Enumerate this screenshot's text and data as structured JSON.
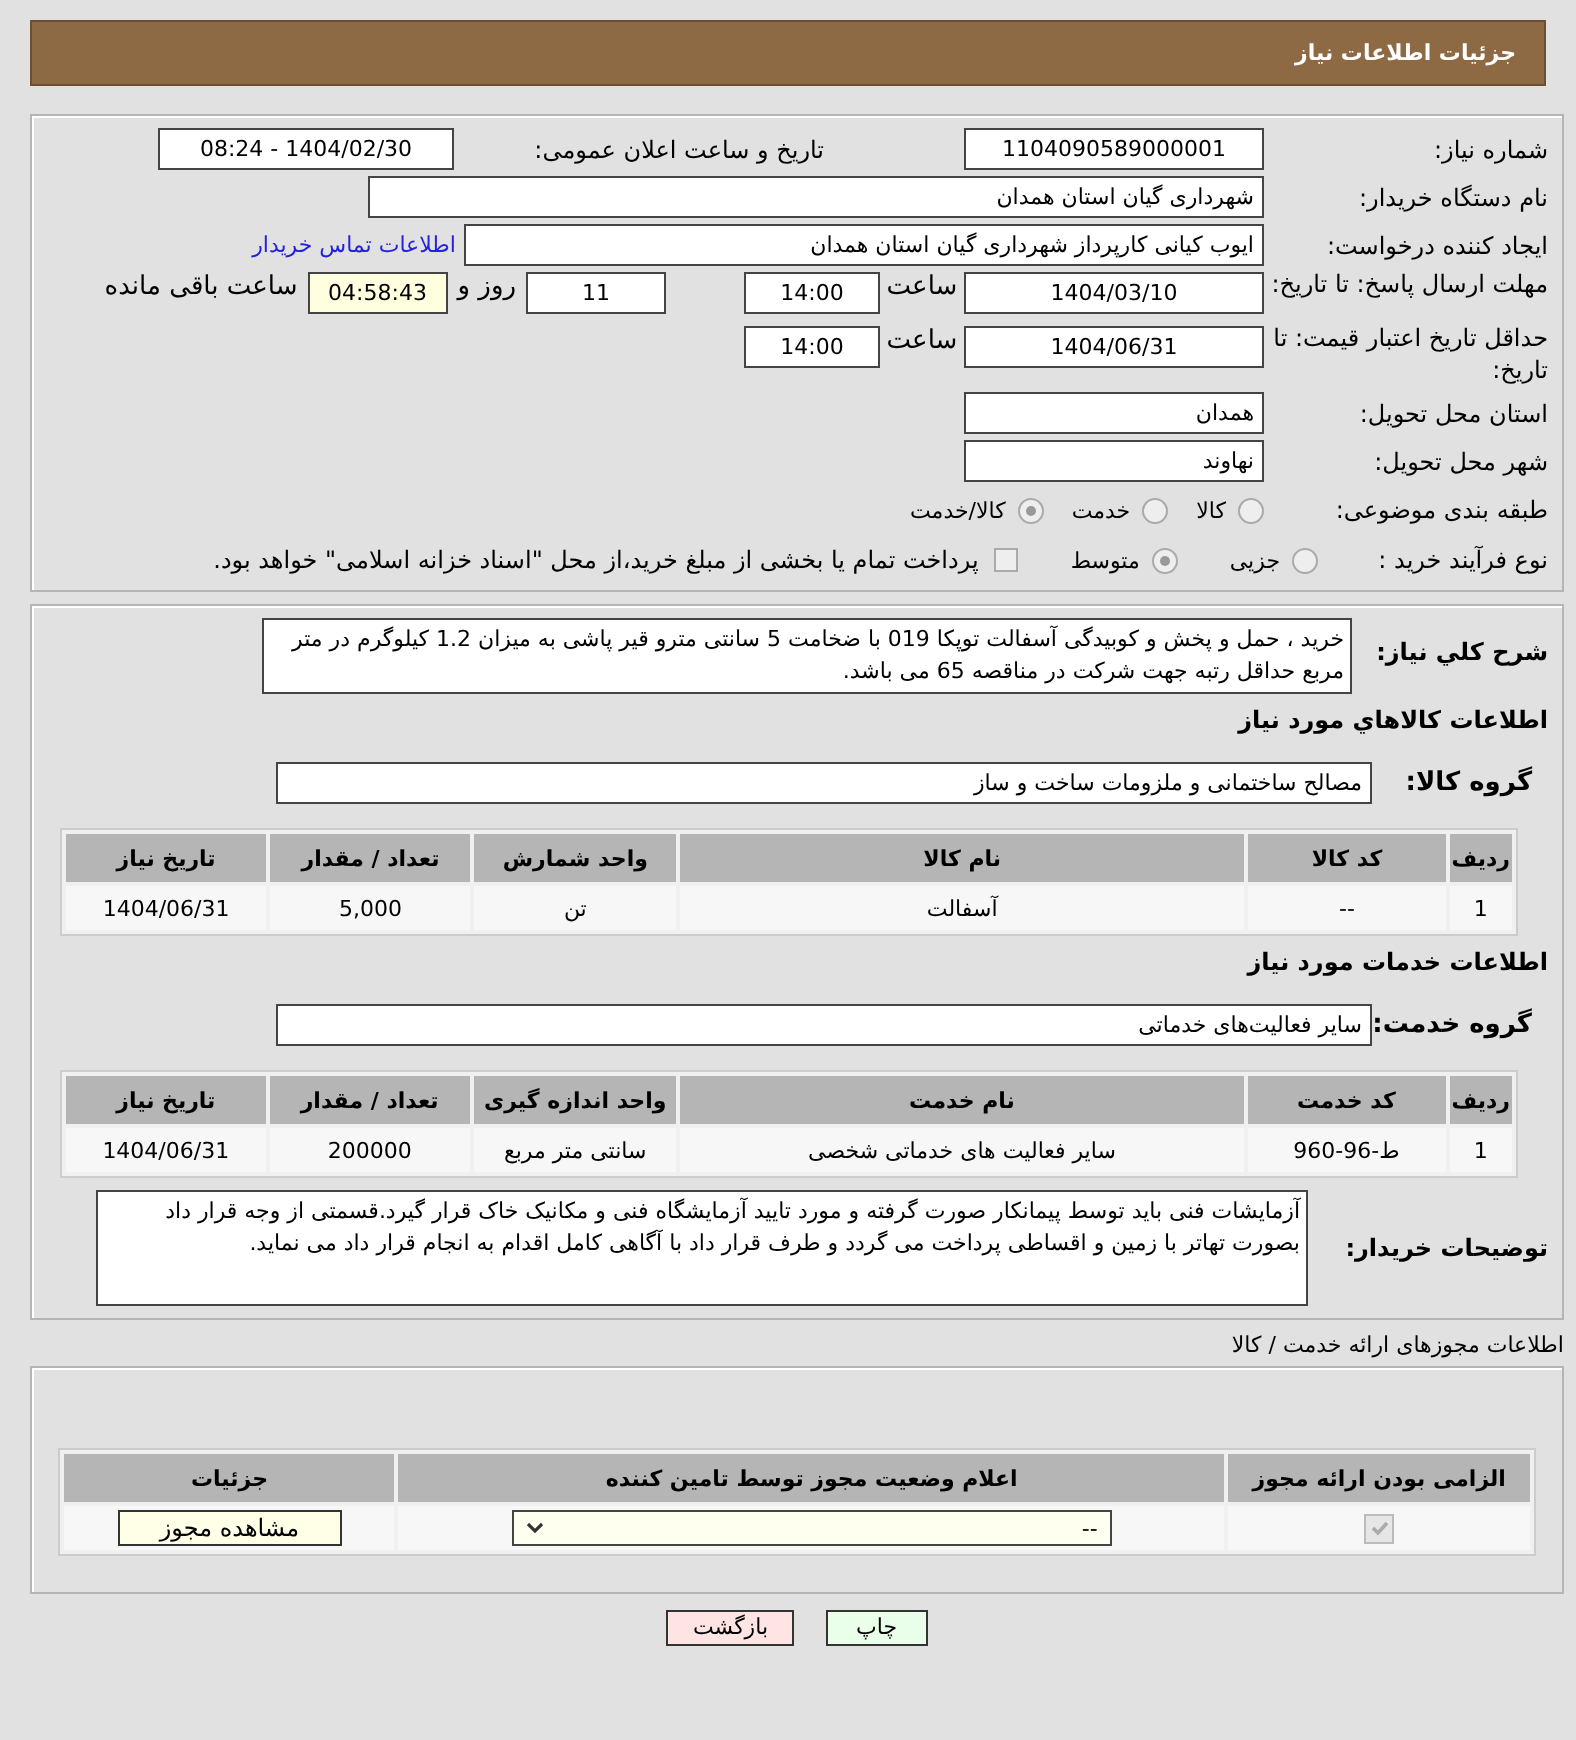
{
  "header": {
    "title": "جزئیات اطلاعات نیاز"
  },
  "need_number": {
    "label": "شماره نیاز:",
    "value": "1104090589000001"
  },
  "announce": {
    "label": "تاریخ و ساعت اعلان عمومی:",
    "value": "1404/02/30 - 08:24"
  },
  "buyer": {
    "label": "نام دستگاه خریدار:",
    "value": "شهرداری گیان استان همدان"
  },
  "requester": {
    "label": "ایجاد کننده درخواست:",
    "value": "ایوب  کیانی کارپرداز شهرداری گیان استان همدان",
    "link": "اطلاعات تماس خریدار"
  },
  "deadline": {
    "label": "مهلت ارسال پاسخ: تا تاریخ:",
    "date": "1404/03/10",
    "time_label": "ساعت",
    "time": "14:00",
    "days": "11",
    "days_label": "روز و",
    "remaining": "04:58:43",
    "remaining_label": "ساعت باقی مانده"
  },
  "validity": {
    "label": "حداقل تاریخ اعتبار قیمت: تا تاریخ:",
    "date": "1404/06/31",
    "time_label": "ساعت",
    "time": "14:00"
  },
  "province": {
    "label": "استان محل تحویل:",
    "value": "همدان"
  },
  "city": {
    "label": "شهر محل تحویل:",
    "value": "نهاوند"
  },
  "category": {
    "label": "طبقه بندی موضوعی:",
    "options": [
      {
        "label": "کالا",
        "selected": false
      },
      {
        "label": "خدمت",
        "selected": false
      },
      {
        "label": "کالا/خدمت",
        "selected": true
      }
    ]
  },
  "process": {
    "label": "نوع فرآیند خرید :",
    "options": [
      {
        "label": "جزیی",
        "selected": false
      },
      {
        "label": "متوسط",
        "selected": true
      }
    ],
    "treasury": {
      "label": "پرداخت تمام یا بخشی از مبلغ خرید،از محل \"اسناد خزانه اسلامی\" خواهد بود.",
      "checked": false
    }
  },
  "description": {
    "label": "شرح کلي نياز:",
    "value": "خرید ، حمل و پخش و کوبیدگی آسفالت توپکا 019 با ضخامت 5 سانتی مترو قیر پاشی به میزان 1.2 کیلوگرم در متر مربع حداقل رتبه جهت شرکت در مناقصه 65 می باشد."
  },
  "goods": {
    "title": "اطلاعات کالاهاي مورد نياز",
    "group_label": "گروه کالا:",
    "group": "مصالح ساختمانی و ملزومات ساخت و ساز",
    "columns": [
      "ردیف",
      "کد کالا",
      "نام کالا",
      "واحد شمارش",
      "تعداد / مقدار",
      "تاریخ نیاز"
    ],
    "rows": [
      [
        "1",
        "--",
        "آسفالت",
        "تن",
        "5,000",
        "1404/06/31"
      ]
    ]
  },
  "services": {
    "title": "اطلاعات خدمات مورد نياز",
    "group_label": "گروه خدمت:",
    "group": "سایر فعالیت‌های خدماتی",
    "columns": [
      "ردیف",
      "کد خدمت",
      "نام خدمت",
      "واحد اندازه گیری",
      "تعداد / مقدار",
      "تاریخ نیاز"
    ],
    "rows": [
      [
        "1",
        "ط-96-960",
        "سایر فعالیت های خدماتی شخصی",
        "سانتی متر مربع",
        "200000",
        "1404/06/31"
      ]
    ]
  },
  "buyer_notes": {
    "label": "توضیحات خریدار:",
    "value": "آزمایشات فنی باید توسط پیمانکار صورت گرفته و مورد تایید آزمایشگاه فنی و مکانیک خاک قرار گیرد.قسمتی از وجه قرار داد بصورت تهاتر با زمین و اقساطی پرداخت می گردد و طرف قرار داد با آگاهی کامل اقدام به انجام قرار داد می نماید."
  },
  "licenses": {
    "title": "اطلاعات مجوزهای ارائه خدمت / کالا",
    "columns": [
      "الزامی بودن ارائه مجوز",
      "اعلام وضعیت مجوز توسط تامین کننده",
      "جزئیات"
    ],
    "rows": [
      {
        "required": true,
        "status": "--",
        "button": "مشاهده مجوز"
      }
    ]
  },
  "buttons": [
    {
      "label": "چاپ",
      "kind": "print"
    },
    {
      "label": "بازگشت",
      "kind": "back"
    }
  ]
}
